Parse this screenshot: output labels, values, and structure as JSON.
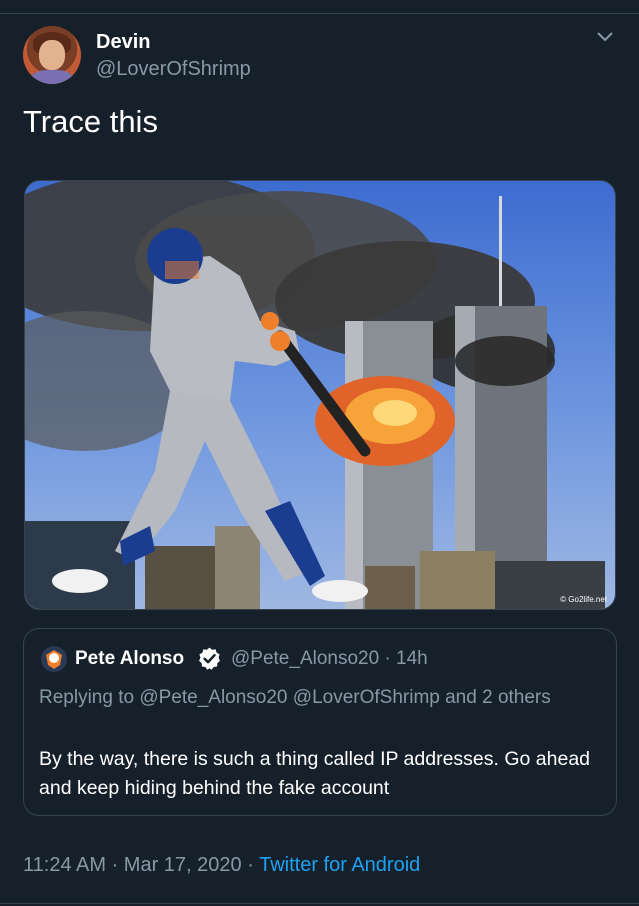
{
  "tweet": {
    "author": {
      "display_name": "Devin",
      "handle": "@LoverOfShrimp"
    },
    "text": "Trace this",
    "media": {
      "watermark": "© Go2life.net"
    },
    "quoted": {
      "display_name": "Pete Alonso",
      "handle_time": "@Pete_Alonso20 · 14h",
      "reply_line": "Replying to @Pete_Alonso20 @LoverOfShrimp and 2 others",
      "text": "By the way, there is such a thing called IP addresses. Go ahead and keep hiding behind the fake account"
    },
    "timestamp": "11:24 AM · Mar 17, 2020",
    "separator": " · ",
    "source": "Twitter for Android"
  },
  "icons": [
    "chevron-down-icon",
    "verified-badge-icon"
  ],
  "colors": {
    "background": "#15202b",
    "secondary_text": "#8899a6",
    "link": "#1da1f2",
    "border": "#38444d"
  }
}
